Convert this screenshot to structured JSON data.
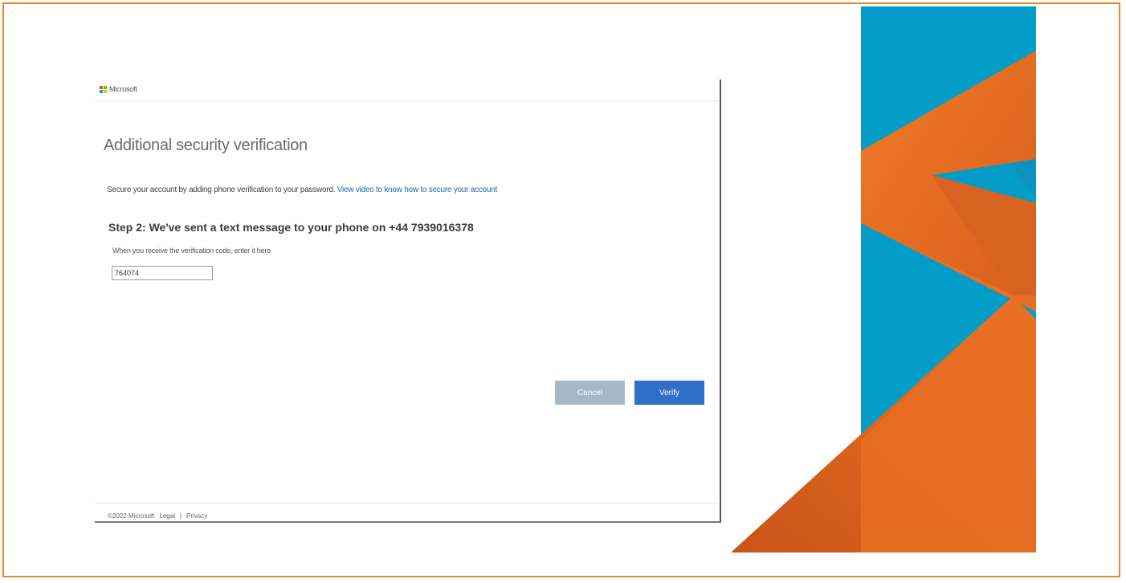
{
  "brand": {
    "name": "Microsoft",
    "logo_colors": [
      "#f25022",
      "#7fba00",
      "#00a4ef",
      "#ffb900"
    ]
  },
  "page": {
    "title": "Additional security verification",
    "intro_text": "Secure your account by adding phone verification to your password.",
    "intro_link": "View video to know how to secure your account",
    "step_heading": "Step 2: We've sent a text message to your phone on +44 7939016378",
    "code_label": "When you receive the verification code, enter it here",
    "code_value": "764074"
  },
  "buttons": {
    "cancel": "Cancel",
    "verify": "Verify"
  },
  "footer": {
    "copyright": "©2022 Microsoft",
    "legal": "Legal",
    "separator": "|",
    "privacy": "Privacy"
  },
  "colors": {
    "frame_border": "#e8862d",
    "deco_blue": "#049dc8",
    "deco_orange": "#e86f25",
    "verify_button": "#2f6fc7",
    "cancel_button": "#a6b9c8",
    "link": "#2266b7"
  }
}
